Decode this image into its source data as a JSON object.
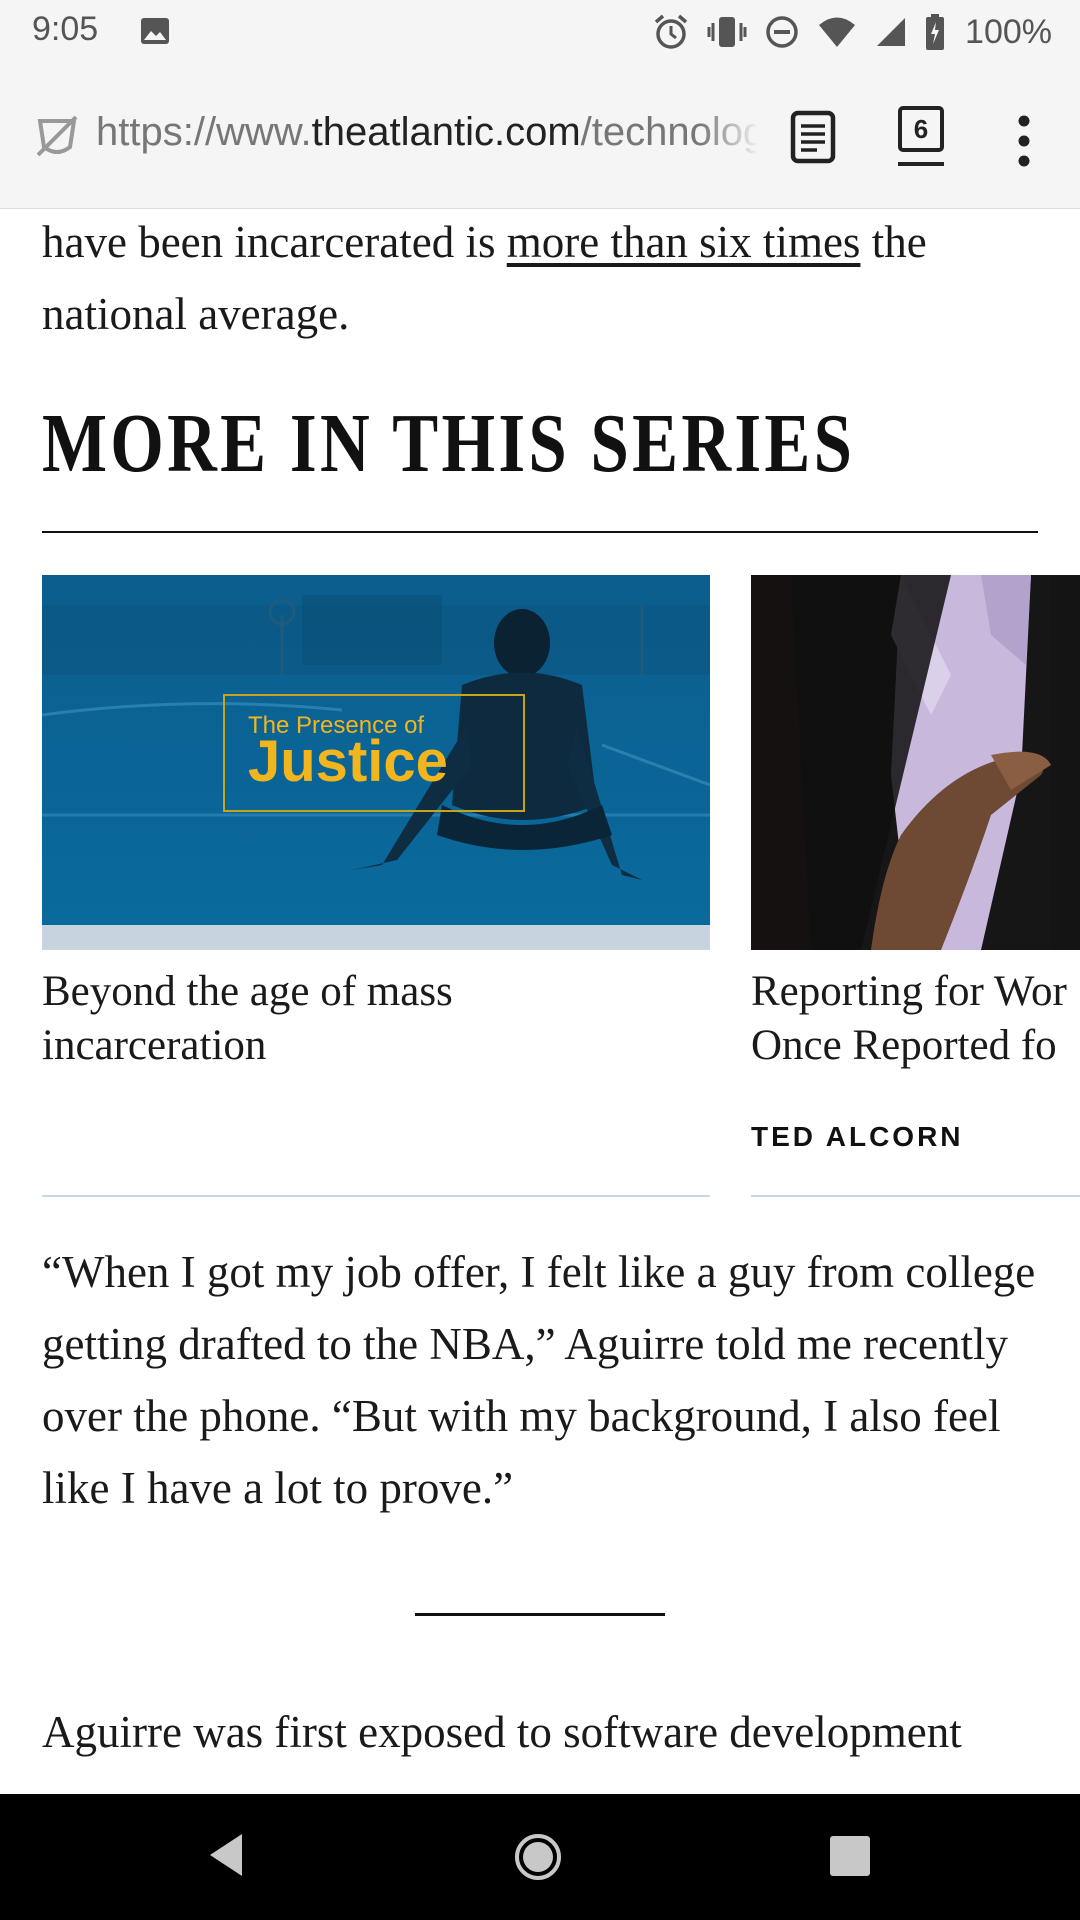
{
  "status_bar": {
    "time": "9:05",
    "battery": "100%",
    "icons": [
      "image-icon",
      "alarm-icon",
      "vibrate-icon",
      "do-not-disturb-icon",
      "wifi-icon",
      "signal-icon",
      "battery-charging-icon"
    ]
  },
  "browser": {
    "url_prefix": "https://www.",
    "url_domain": "theatlantic.com",
    "url_path": "/technology/archive",
    "tab_count": "6",
    "icons": [
      "site-shield-icon",
      "reader-mode-icon",
      "tabs-icon",
      "more-vert-icon"
    ]
  },
  "article": {
    "para1_before": "have been incarcerated is ",
    "para1_link": "more than six times",
    "para1_after": " the national average.",
    "series_heading": "MORE IN THIS SERIES",
    "cards": [
      {
        "image_overlay_small": "The Presence of",
        "image_overlay_large": "Justice",
        "title_line1": "Beyond the age of mass",
        "title_line2": "incarceration",
        "byline": ""
      },
      {
        "title_line1": "Reporting for Wor",
        "title_line2": "Once Reported fo",
        "byline": "TED ALCORN"
      }
    ],
    "para2": "“When I got my job offer, I felt like a guy from college getting drafted to the NBA,” Aguirre told me recently over the phone. “But with my background, I also feel like I have a lot to prove.”",
    "para3": "Aguirre was first exposed to software development"
  },
  "colors": {
    "card1_image_blue": "#0a5f8f",
    "justice_yellow": "#f2b51e",
    "card_rule": "#c9d6e2"
  },
  "nav_bar": {
    "icons": [
      "back-icon",
      "home-icon",
      "recents-icon"
    ]
  }
}
